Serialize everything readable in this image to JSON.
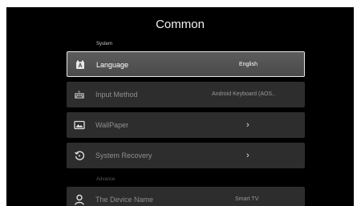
{
  "page": {
    "title": "Common"
  },
  "sections": {
    "system": "System",
    "advance": "Advance"
  },
  "rows": [
    {
      "icon": "language-icon",
      "label": "Language",
      "value": "English",
      "focused": true
    },
    {
      "icon": "keyboard-icon",
      "label": "Input Method",
      "value": "Android Keyboard (AOS.."
    },
    {
      "icon": "wallpaper-icon",
      "label": "WallPaper",
      "value": "›"
    },
    {
      "icon": "system-recovery-icon",
      "label": "System Recovery",
      "value": "›"
    },
    {
      "icon": "person-icon",
      "label": "The Device Name",
      "value": "Smart TV"
    }
  ],
  "colors": {
    "background": "#000000",
    "row": "#2d2d2d",
    "row_focused": "#555555",
    "focus_border": "#e6e6e6"
  }
}
